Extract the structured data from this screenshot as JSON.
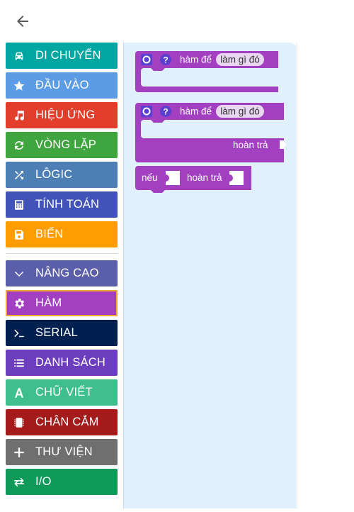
{
  "toolbox": {
    "categories": [
      {
        "label": "DI CHUYỂN",
        "color": "#00a6a1",
        "icon": "car-icon"
      },
      {
        "label": "ĐẦU VÀO",
        "color": "#5c9ce6",
        "icon": "star-icon"
      },
      {
        "label": "HIỆU ỨNG",
        "color": "#e33e2b",
        "icon": "music-note-icon"
      },
      {
        "label": "VÒNG LẶP",
        "color": "#3fa53f",
        "icon": "refresh-icon"
      },
      {
        "label": "LÔGIC",
        "color": "#4e7fb4",
        "icon": "shuffle-icon"
      },
      {
        "label": "TÍNH TOÁN",
        "color": "#4152b8",
        "icon": "calculator-icon"
      },
      {
        "label": "BIẾN",
        "color": "#ff9c00",
        "icon": "save-icon"
      }
    ],
    "advanced": [
      {
        "label": "NÂNG CAO",
        "color": "#5b5ea8",
        "icon": "chevron-down-icon"
      },
      {
        "label": "HÀM",
        "color": "#a33fc1",
        "icon": "gear-icon"
      },
      {
        "label": "SERIAL",
        "color": "#002050",
        "icon": "terminal-icon"
      },
      {
        "label": "DANH SÁCH",
        "color": "#6c3dbd",
        "icon": "list-icon"
      },
      {
        "label": "CHỮ VIẾT",
        "color": "#3fbe8e",
        "icon": "letter-a-icon"
      },
      {
        "label": "CHÂN CẮM",
        "color": "#a51a1a",
        "icon": "chip-icon"
      },
      {
        "label": "THƯ VIỆN",
        "color": "#6f6f6f",
        "icon": "plus-icon"
      },
      {
        "label": "I/O",
        "color": "#0f9a59",
        "icon": "transfer-icon"
      }
    ]
  },
  "flyout": {
    "block1": {
      "prefix": "hàm để",
      "name": "làm gì đó"
    },
    "block2": {
      "prefix": "hàm để",
      "name": "làm gì đó",
      "return_label": "hoàn trả"
    },
    "block3": {
      "if_label": "nếu",
      "return_label": "hoàn trả"
    },
    "block_color": "#a33fc1"
  }
}
